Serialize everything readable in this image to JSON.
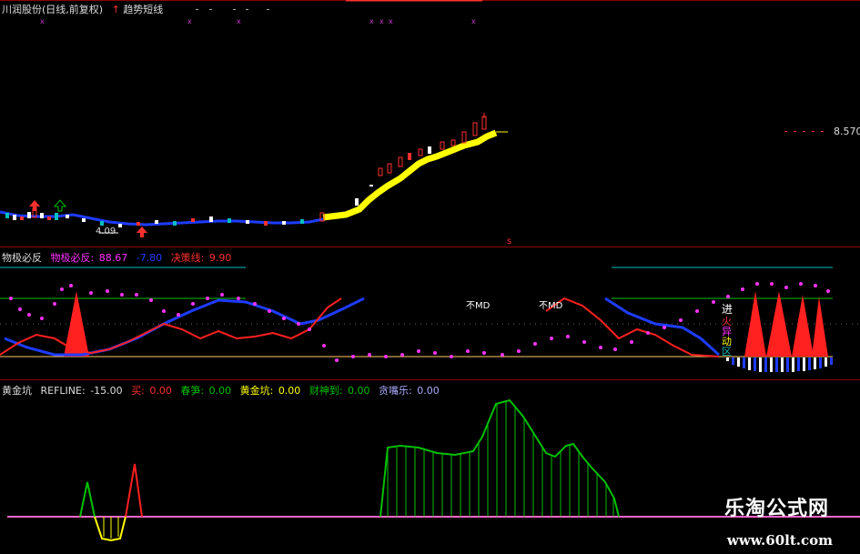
{
  "price_pane": {
    "stock_title": "川润股份(日线,前复权)",
    "indicator_label": "趋势短线",
    "price_high_label": "8.570",
    "price_low_label": "4.09",
    "arrow_up": "↑"
  },
  "mid_pane": {
    "name": "物极必反",
    "val1_label": "物极必反:",
    "val1": "88.67",
    "val2": "-7.80",
    "val3_label": "决策线:",
    "val3": "9.90",
    "signal_in": "进",
    "signal_v1": "火",
    "signal_v2": "异",
    "signal_v3": "动",
    "signal_v4": "区",
    "t1": "不MD",
    "t2": "不MD",
    "colors": {
      "up": "#ff0000",
      "down": "#ffffff",
      "blue": "#1e3cff",
      "magenta": "#ff33ff",
      "green": "#00c000",
      "cyan": "#00bfbf"
    }
  },
  "low_pane": {
    "name": "黄金坑",
    "refline_label": "REFLINE:",
    "refline": "-15.00",
    "l1": "买:",
    "v1": "0.00",
    "l2": "春笋:",
    "v2": "0.00",
    "l3": "黄金坑:",
    "v3": "0.00",
    "l4": "财神到:",
    "v4": "0.00",
    "l5": "贪嘴乐:",
    "v5": "0.00"
  },
  "watermark": {
    "site_name": "乐淘公式网",
    "site_url": "www.60lt.com"
  }
}
